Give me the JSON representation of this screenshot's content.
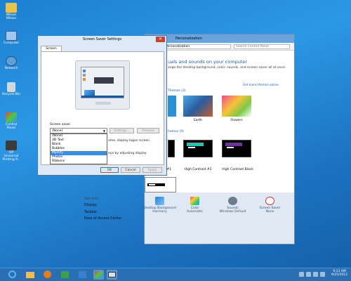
{
  "desktop": {
    "icons": [
      {
        "label": "Wilson Wilson",
        "icon": "user-folder-icon"
      },
      {
        "label": "Computer",
        "icon": "computer-icon"
      },
      {
        "label": "Network",
        "icon": "network-icon"
      },
      {
        "label": "Recycle Bin",
        "icon": "recycle-bin-icon"
      },
      {
        "label": "Control Panel",
        "icon": "control-panel-icon"
      },
      {
        "label": "HP Universal Printing P...",
        "icon": "printer-icon"
      }
    ]
  },
  "personalization": {
    "title": "Personalization",
    "breadcrumb": "Personalization",
    "search_placeholder": "Search Control Panel",
    "heading": "uals and sounds on your computer",
    "subtext": "ange the desktop background, color, sounds, and screen saver all at once.",
    "online_link": "Get more themes online",
    "my_themes_label": "Themes (3)",
    "basic_themes_label": "hemes (4)",
    "themes": [
      {
        "label": "Earth"
      },
      {
        "label": "Flowers"
      }
    ],
    "hc_themes": [
      {
        "label": "st #1"
      },
      {
        "label": "High Contrast #2"
      },
      {
        "label": "High Contrast Black"
      }
    ],
    "footer": [
      {
        "label": "Desktop Background",
        "sub": "Harmony",
        "icon": "desktop-background-icon"
      },
      {
        "label": "Color",
        "sub": "Automatic",
        "icon": "color-icon"
      },
      {
        "label": "Sounds",
        "sub": "Windows Default",
        "icon": "sounds-icon"
      },
      {
        "label": "Screen Saver",
        "sub": "None",
        "icon": "screen-saver-icon"
      }
    ]
  },
  "see_also": {
    "title": "See also",
    "items": [
      "Display",
      "Taskbar",
      "Ease of Access Center"
    ]
  },
  "screen_saver": {
    "title": "Screen Saver Settings",
    "tab": "Screen Saver",
    "section_label": "Screen saver",
    "selected": "(None)",
    "options": [
      "(None)",
      "3D Text",
      "Blank",
      "Bubbles",
      "Mystify",
      "Photos",
      "Ribbons"
    ],
    "highlighted": "Mystify",
    "settings_btn": "Settings...",
    "preview_btn": "Preview",
    "logon_text": "ome, display logon screen",
    "power_text": "nce by adjusting display",
    "power_link": "Change power settings",
    "ok": "OK",
    "cancel": "Cancel",
    "apply": "Apply"
  },
  "taskbar": {
    "time": "9:13 AM",
    "date": "9/25/2012"
  }
}
